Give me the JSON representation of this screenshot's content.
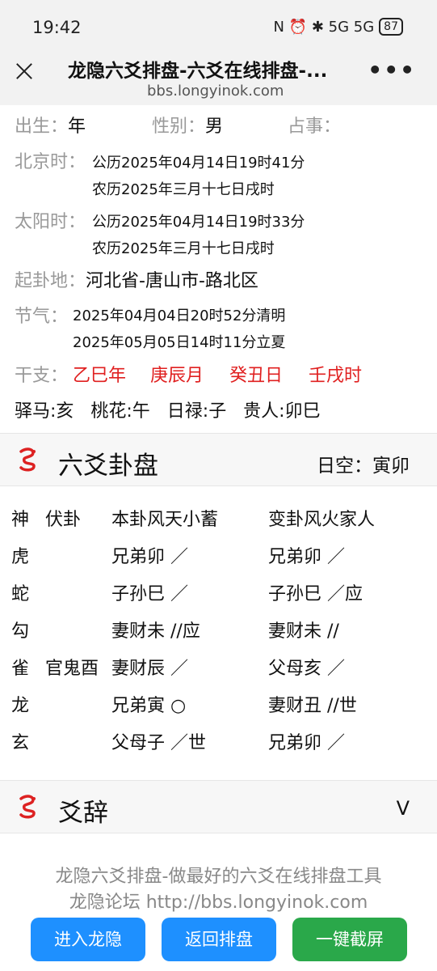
{
  "status": {
    "time": "19:42",
    "icons": "N ⏰ ✱ 5G 5G",
    "battery": "87"
  },
  "titlebar": {
    "title": "龙隐六爻排盘-六爻在线排盘-...",
    "url": "bbs.longyinok.com"
  },
  "info": {
    "birth_label": "出生：",
    "birth_val": "年",
    "gender_label": "性别：",
    "gender_val": "男",
    "divine_label": "占事：",
    "beijing_label": "北京时：",
    "beijing_1": "公历2025年04月14日19时41分",
    "beijing_2": "农历2025年三月十七日戌时",
    "solar_label": "太阳时：",
    "solar_1": "公历2025年04月14日19时33分",
    "solar_2": "农历2025年三月十七日戌时",
    "place_label": "起卦地：",
    "place_val": "河北省-唐山市-路北区",
    "jieqi_label": "节气：",
    "jieqi_1": "2025年04月04日20时52分清明",
    "jieqi_2": "2025年05月05日14时11分立夏",
    "ganzhi_label": "干支：",
    "ganzhi": [
      "乙巳年",
      "庚辰月",
      "癸丑日",
      "壬戌时"
    ],
    "extras": "驿马:亥   桃花:午   日禄:子   贵人:卯巳"
  },
  "section1": {
    "title": "六爻卦盘",
    "right": "日空：寅卯"
  },
  "grid": {
    "header": {
      "c1": "神",
      "c2": "伏卦",
      "c3": "本卦风天小蓄",
      "c4": "变卦风火家人"
    },
    "rows": [
      {
        "c1": "虎",
        "c2": "",
        "c3": "兄弟卯 ／",
        "c4": "兄弟卯 ／"
      },
      {
        "c1": "蛇",
        "c2": "",
        "c3": "子孙巳 ／",
        "c4": "子孙巳 ／应"
      },
      {
        "c1": "勾",
        "c2": "",
        "c3": "妻财未 //应",
        "c4": "妻财未 //"
      },
      {
        "c1": "雀",
        "c2": "官鬼酉",
        "c3": "妻财辰 ／",
        "c4": "父母亥 ／"
      },
      {
        "c1": "龙",
        "c2": "",
        "c3": "兄弟寅 ○",
        "c4": "妻财丑 //世"
      },
      {
        "c1": "玄",
        "c2": "",
        "c3": "父母子 ／世",
        "c4": "兄弟卯 ／"
      }
    ]
  },
  "section2": {
    "title": "爻辞",
    "chevron": "V"
  },
  "footer": {
    "line1": "龙隐六爻排盘-做最好的六爻在线排盘工具",
    "line2": "龙隐论坛 http://bbs.longyinok.com",
    "btn_enter": "进入龙隐",
    "btn_back": "返回排盘",
    "btn_shot": "一键截屏"
  }
}
